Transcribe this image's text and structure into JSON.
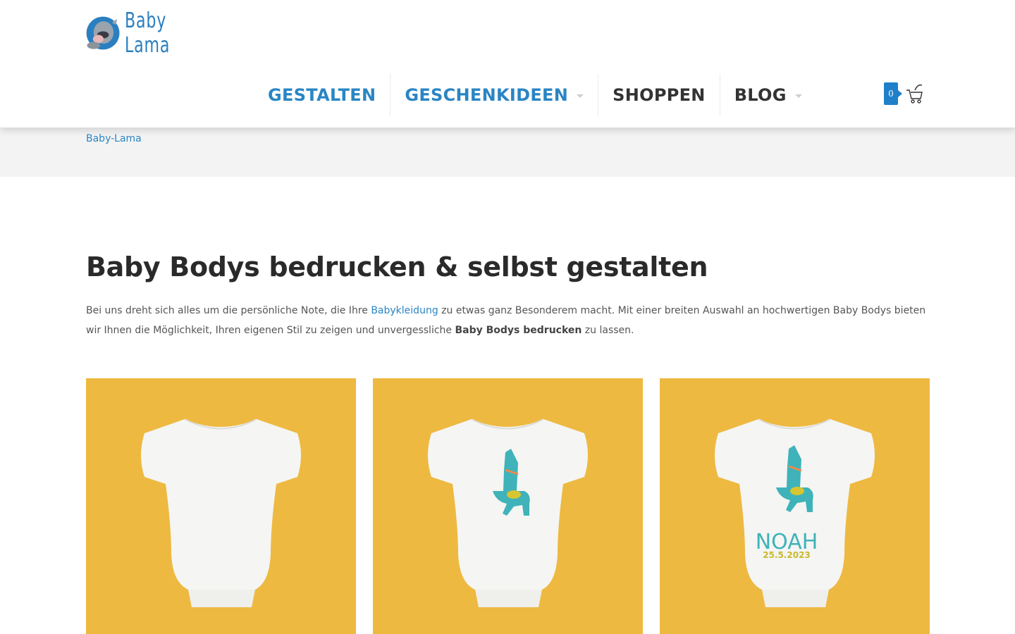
{
  "brand": {
    "name": "Baby Lama"
  },
  "nav": {
    "items": [
      {
        "label": "GESTALTEN",
        "has_dropdown": false
      },
      {
        "label": "GESCHENKIDEEN",
        "has_dropdown": true
      },
      {
        "label": "SHOPPEN",
        "has_dropdown": false
      },
      {
        "label": "BLOG",
        "has_dropdown": true
      }
    ]
  },
  "cart": {
    "count": "0",
    "icon": "shopping-cart-icon"
  },
  "breadcrumb": {
    "home": "Baby-Lama"
  },
  "main": {
    "title": "Baby Bodys bedrucken & selbst gestalten",
    "intro": {
      "part1": "Bei uns dreht sich alles um die persönliche Note, die Ihre ",
      "link": "Babykleidung",
      "part2": " zu etwas ganz Besonderem macht. Mit einer breiten Auswahl an hochwertigen Baby Bodys bieten wir Ihnen die Möglichkeit, Ihren eigenen Stil zu zeigen und unvergessliche ",
      "bold": "Baby Bodys bedrucken",
      "part3": " zu lassen."
    },
    "products": [
      {
        "variant": "plain"
      },
      {
        "variant": "llama"
      },
      {
        "variant": "llama-name",
        "print_name": "NOAH",
        "print_date": "25.5.2023"
      }
    ]
  },
  "colors": {
    "accent": "#2a85c4",
    "card_bg": "#eeb941",
    "llama": "#3fb3b9"
  }
}
